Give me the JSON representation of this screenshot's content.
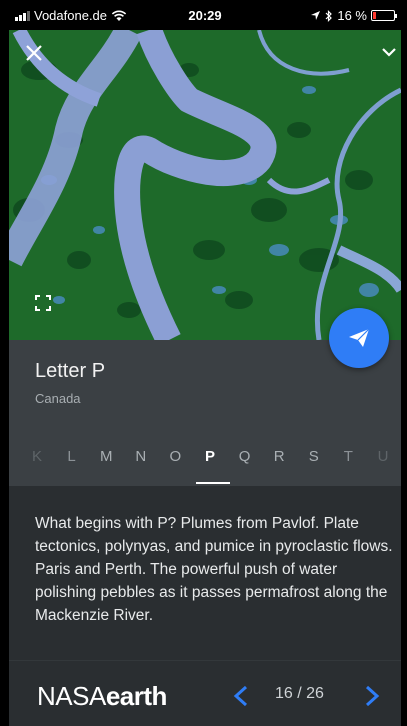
{
  "status_bar": {
    "carrier": "Vodafone.de",
    "time": "20:29",
    "battery": "16 %",
    "battery_level": 0.16
  },
  "hero": {
    "close_icon": "close-icon",
    "collapse_icon": "chevron-down-icon",
    "expand_icon": "fullscreen-icon",
    "share_icon": "paper-plane-icon"
  },
  "place": {
    "title": "Letter P",
    "subtitle": "Canada"
  },
  "alphabet": {
    "letters": [
      "K",
      "L",
      "M",
      "N",
      "O",
      "P",
      "Q",
      "R",
      "S",
      "T",
      "U"
    ],
    "selected": "P"
  },
  "description": "What begins with P? Plumes from Pavlof. Plate tectonics, polynyas, and pumice in pyroclastic flows. Paris and Perth. The powerful push of water polishing pebbles as it passes permafrost along the Mackenzie River.",
  "footer": {
    "logo_light": "NASA",
    "logo_bold": "earth",
    "page": "16 / 26"
  },
  "colors": {
    "accent": "#2f7df6",
    "panel": "#3b4044",
    "background": "#2a2e31"
  }
}
